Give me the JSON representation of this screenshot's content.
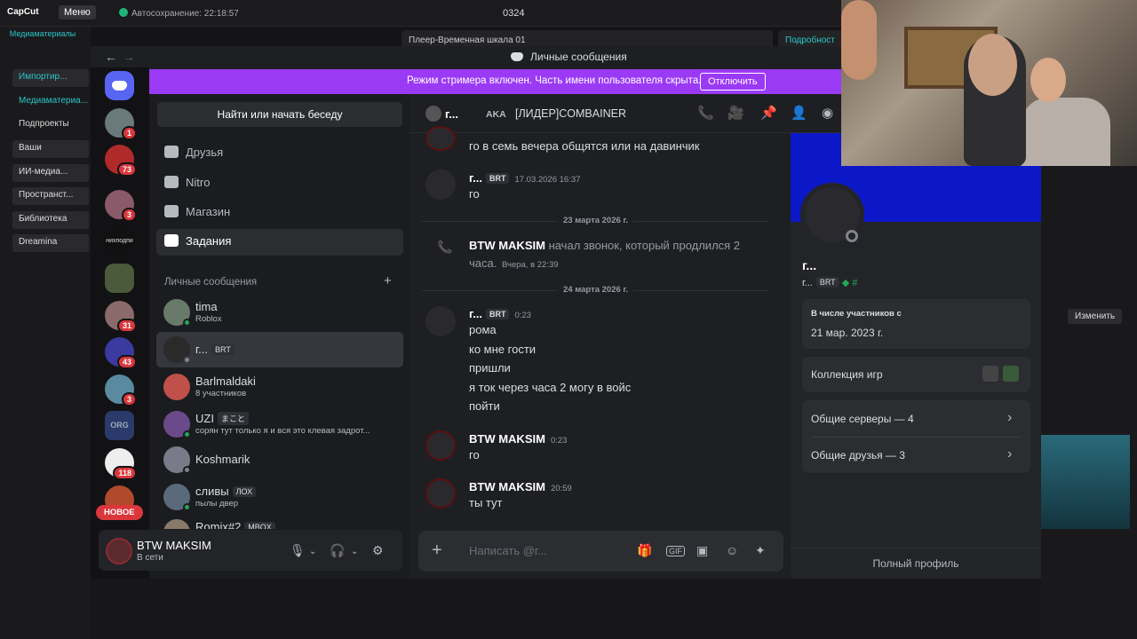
{
  "capcut": {
    "logo": "CapCut",
    "menu": "Меню",
    "autosave": "Автосохранение: 22:18:57",
    "project_title": "0324",
    "left_tab": "Медиаматериалы",
    "side_items": [
      "Импортир...",
      "Медиаматериа...",
      "Подпроекты",
      "Ваши",
      "ИИ-медиа...",
      "Пространст...",
      "Библиотека",
      "Dreamina"
    ],
    "player_tab": "Плеер-Временная шкала 01",
    "detail_tab": "Подробност",
    "change_btn": "Изменить"
  },
  "discord": {
    "window_title": "Личные сообщения",
    "streamer_banner": "Режим стримера включен. Часть имени пользователя скрыта.",
    "streamer_button": "Отключить",
    "servers": [
      {
        "badge": "1"
      },
      {
        "badge": "73"
      },
      {
        "badge": ""
      },
      {
        "badge": "3"
      },
      {
        "label": "нихподпи"
      },
      {
        "badge": ""
      },
      {
        "badge": "31"
      },
      {
        "badge": "43"
      },
      {
        "badge": "3"
      },
      {
        "label": "ORG"
      },
      {
        "badge": "118"
      },
      {
        "badge": ""
      }
    ],
    "new_badge": "НОВОЕ",
    "find_button": "Найти или начать беседу",
    "nav": {
      "friends": "Друзья",
      "nitro": "Nitro",
      "shop": "Магазин",
      "tasks": "Задания"
    },
    "dm_header": "Личные сообщения",
    "dm_add": "+",
    "dms": [
      {
        "name": "tima",
        "sub": "Roblox",
        "tag": ""
      },
      {
        "name": "г...",
        "sub": "",
        "tag": "BRT"
      },
      {
        "name": "Barlmaldaki",
        "sub": "8 участников",
        "tag": ""
      },
      {
        "name": "UZI",
        "sub": "сорян тут только я и вся это клевая задрот...",
        "tag": "まこと"
      },
      {
        "name": "Koshmarik",
        "sub": "",
        "tag": ""
      },
      {
        "name": "сливы",
        "sub": "пылы двер",
        "tag": "ЛОХ"
      },
      {
        "name": "Romix#2",
        "sub": "",
        "tag": "MBOX"
      }
    ],
    "user": {
      "name": "BTW MAKSIM",
      "status": "В сети"
    },
    "chat_header": {
      "name": "г...",
      "aka": "AKA",
      "nick": "[ЛИДЕР]COMBAINER"
    },
    "messages": {
      "m0": {
        "text": "го в семь вечера общятся или на давинчик"
      },
      "m1": {
        "name": "г...",
        "tag": "BRT",
        "time": "17.03.2026 16:37",
        "text": "го"
      },
      "d1": "23 марта 2026 г.",
      "call": {
        "name": "BTW MAKSIM",
        "text": "начал звонок, который продлился 2",
        "text2": "часа.",
        "time": "Вчера, в 22:39"
      },
      "d2": "24 марта 2026 г.",
      "m2": {
        "name": "г...",
        "tag": "BRT",
        "time": "0:23",
        "lines": [
          "рома",
          "ко мне гости",
          "пришли",
          "я ток через часа 2 могу в войс",
          "пойти"
        ]
      },
      "m3": {
        "name": "BTW MAKSIM",
        "time": "0:23",
        "text": "го"
      },
      "m4": {
        "name": "BTW MAKSIM",
        "time": "20:59",
        "text": "ты тут"
      }
    },
    "composer_placeholder": "Написать @г...",
    "profile": {
      "name": "г...",
      "handle": "г...",
      "tag": "BRT",
      "member_since_label": "В числе участников с",
      "member_since": "21 мар. 2023 г.",
      "games": "Коллекция игр",
      "servers": "Общие серверы — 4",
      "friends": "Общие друзья — 3",
      "full_profile": "Полный профиль"
    }
  },
  "colors": {
    "streamer": "#9b3af5",
    "accent": "#5865f2",
    "online": "#23a55a",
    "badge": "#da373c",
    "banner": "#0c18c8"
  }
}
